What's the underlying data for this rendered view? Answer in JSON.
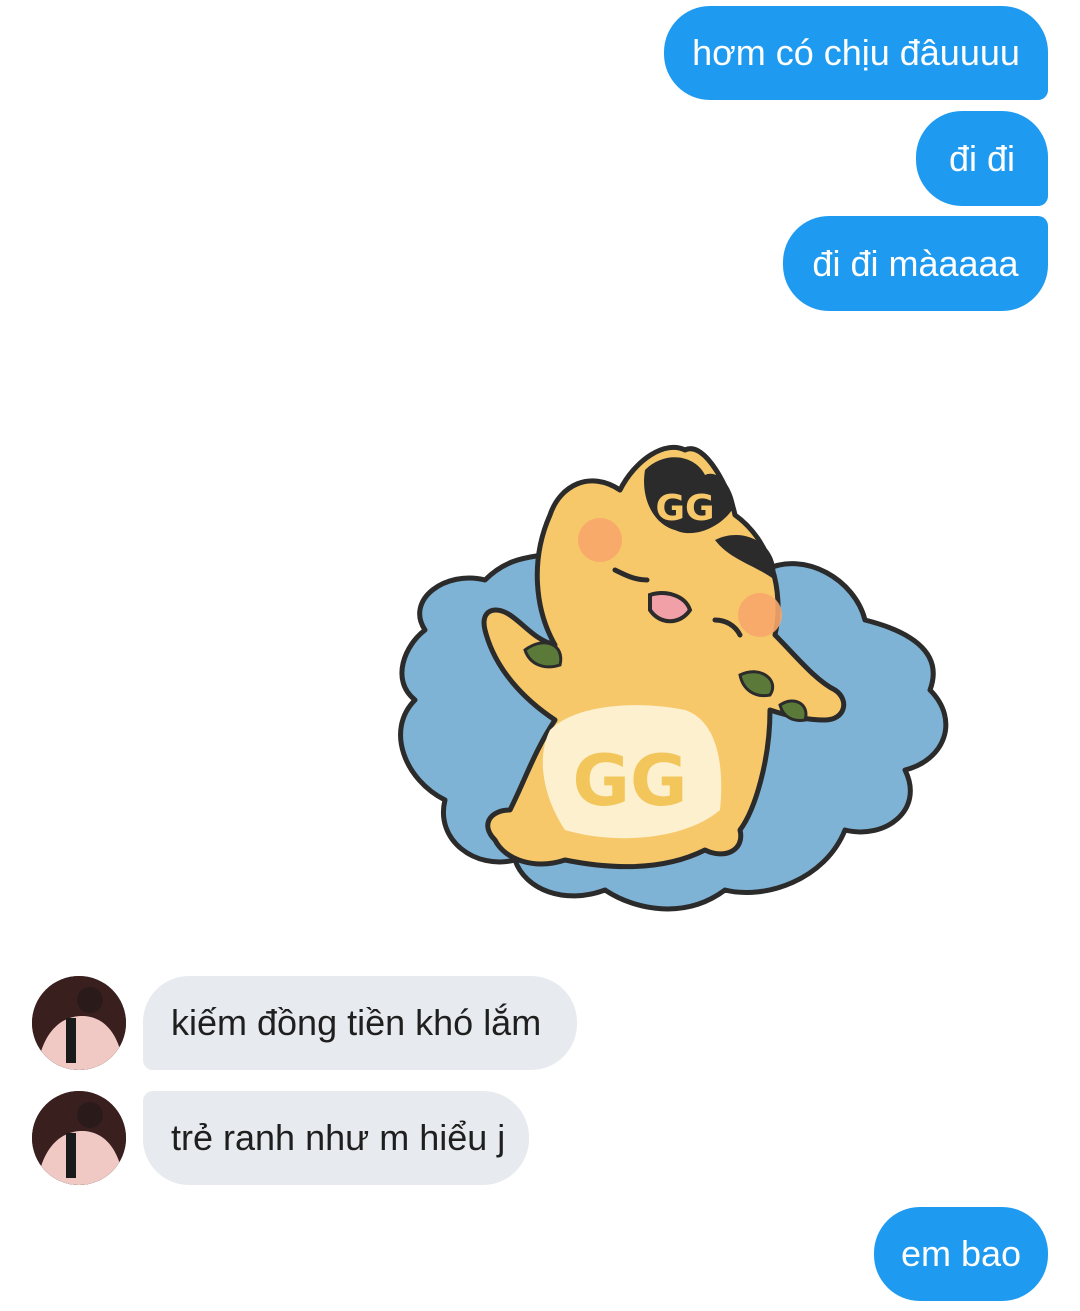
{
  "messages": [
    {
      "side": "out",
      "text": "hơm có chịu đâuuuu"
    },
    {
      "side": "out",
      "text": "đi đi"
    },
    {
      "side": "out",
      "text": "đi đi màaaaa"
    },
    {
      "side": "out",
      "type": "sticker",
      "sticker": "cat-lying-in-puddle-sticker"
    },
    {
      "side": "in",
      "text": "kiếm đồng tiền khó lắm"
    },
    {
      "side": "in",
      "text": "trẻ ranh như m hiểu j"
    },
    {
      "side": "out",
      "text": "em bao"
    }
  ],
  "colors": {
    "outgoing_bubble": "#1e9bf0",
    "incoming_bubble": "#e7eaee",
    "background": "#ffffff"
  }
}
